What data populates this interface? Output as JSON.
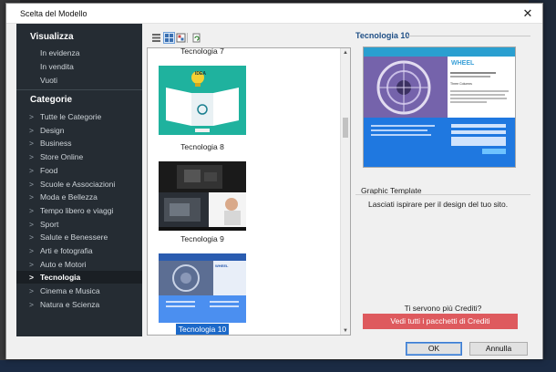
{
  "dialog": {
    "title": "Scelta del Modello"
  },
  "sidebar": {
    "view_heading": "Visualizza",
    "view_items": [
      "In evidenza",
      "In vendita",
      "Vuoti"
    ],
    "categories_heading": "Categorie",
    "categories": [
      {
        "label": "Tutte le Categorie"
      },
      {
        "label": "Design"
      },
      {
        "label": "Business"
      },
      {
        "label": "Store Online"
      },
      {
        "label": "Food"
      },
      {
        "label": "Scuole e Associazioni"
      },
      {
        "label": "Moda e Bellezza"
      },
      {
        "label": "Tempo libero e viaggi"
      },
      {
        "label": "Sport"
      },
      {
        "label": "Salute e Benessere"
      },
      {
        "label": "Arti e fotografia"
      },
      {
        "label": "Auto e Motori"
      },
      {
        "label": "Tecnologia",
        "active": true
      },
      {
        "label": "Cinema e Musica"
      },
      {
        "label": "Natura e Scienza"
      }
    ],
    "chevron": ">"
  },
  "templates": [
    {
      "label": "Tecnologia 7"
    },
    {
      "label": "Tecnologia 8",
      "thumb_text": "IDEA"
    },
    {
      "label": "Tecnologia 9"
    },
    {
      "label": "Tecnologia 10",
      "selected": true,
      "thumb_text": "WHEEL"
    }
  ],
  "detail": {
    "title": "Tecnologia 10",
    "preview_heading": "WHEEL",
    "preview_subheading": "Three Columns",
    "type_label": "Graphic Template",
    "description": "Lasciati ispirare per il design del tuo sito.",
    "credits_question": "Ti servono più Crediti?",
    "credits_button": "Vedi tutti i pacchetti di Crediti"
  },
  "footer": {
    "ok": "OK",
    "cancel": "Annulla"
  },
  "colors": {
    "accent": "#1c69c9",
    "credits": "#de5a5e",
    "sidebar": "#252c33"
  }
}
